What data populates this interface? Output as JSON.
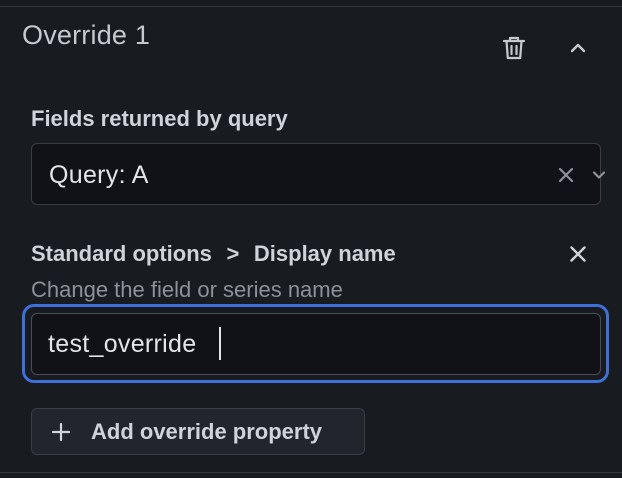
{
  "override": {
    "title": "Override 1",
    "delete_icon": "trash-icon",
    "collapse_icon": "chevron-up-icon"
  },
  "matcher": {
    "label": "Fields returned by query",
    "selected_value": "Query: A",
    "clear_icon": "close-icon",
    "dropdown_icon": "chevron-down-icon"
  },
  "property": {
    "category": "Standard options",
    "separator": ">",
    "name": "Display name",
    "description": "Change the field or series name",
    "value": "test_override",
    "remove_icon": "close-icon"
  },
  "add_property": {
    "label": "Add override property",
    "icon": "plus-icon"
  },
  "colors": {
    "background": "#181b1f",
    "input_background": "#111217",
    "focus_ring": "#3d71d9",
    "text_primary": "#d1d3db",
    "text_secondary": "#8e909a"
  }
}
